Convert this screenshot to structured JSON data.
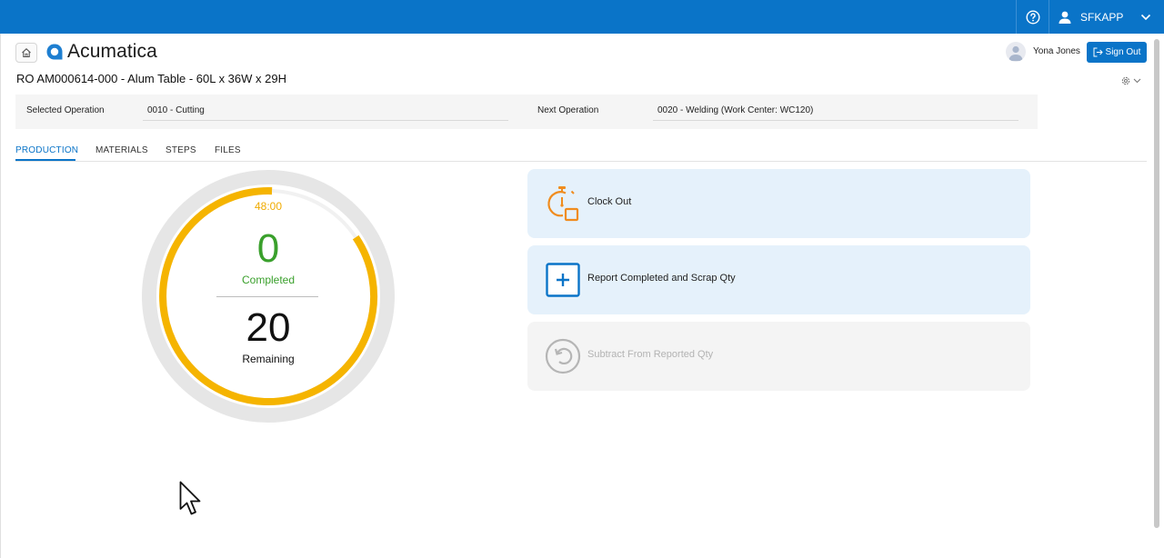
{
  "header": {
    "help_icon": "help-circle-icon",
    "user_icon": "user-icon",
    "company": "SFKAPP",
    "chevron_icon": "chevron-down-icon"
  },
  "nav": {
    "home_icon": "home-icon",
    "logo_text": "Acumatica",
    "user_name": "Yona Jones",
    "sign_out_label": "Sign Out",
    "settings_icon": "gear-icon"
  },
  "page": {
    "title": "RO AM000614-000 - Alum Table - 60L x 36W x 29H"
  },
  "operations": {
    "selected_label": "Selected Operation",
    "selected_value": "0010 - Cutting",
    "next_label": "Next Operation",
    "next_value": "0020 - Welding (Work Center: WC120)"
  },
  "tabs": [
    {
      "label": "PRODUCTION",
      "active": true
    },
    {
      "label": "MATERIALS",
      "active": false
    },
    {
      "label": "STEPS",
      "active": false
    },
    {
      "label": "FILES",
      "active": false
    }
  ],
  "gauge": {
    "timer": "48:00",
    "completed_value": "0",
    "completed_label": "Completed",
    "remaining_value": "20",
    "remaining_label": "Remaining",
    "timer_color": "#f0ab00",
    "completed_color": "#3aa02c",
    "track_color": "#e6e6e6"
  },
  "actions": [
    {
      "label": "Clock Out",
      "icon": "stopwatch-icon",
      "enabled": true
    },
    {
      "label": "Report Completed and Scrap Qty",
      "icon": "plus-box-icon",
      "enabled": true
    },
    {
      "label": "Subtract From Reported Qty",
      "icon": "undo-circle-icon",
      "enabled": false
    }
  ],
  "colors": {
    "brand": "#0a74c8",
    "card_bg": "#e5f1fb",
    "clock_icon": "#f08c1e"
  }
}
